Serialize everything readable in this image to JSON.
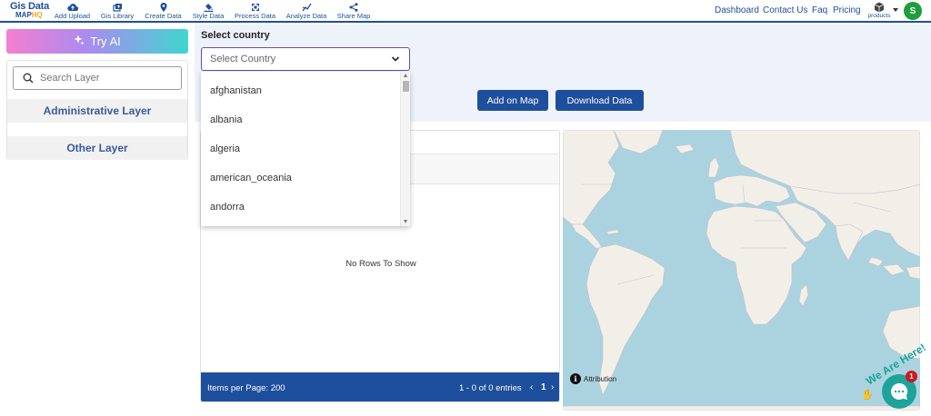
{
  "app": {
    "logo_line1": "Gis Data",
    "logo_line2_a": "MAP",
    "logo_line2_b": "HQ"
  },
  "nav": {
    "items": [
      {
        "label": "Add Upload",
        "icon": "cloud-upload-icon"
      },
      {
        "label": "Gis Library",
        "icon": "library-icon"
      },
      {
        "label": "Create Data",
        "icon": "map-pin-icon"
      },
      {
        "label": "Style Data",
        "icon": "paint-bucket-icon"
      },
      {
        "label": "Process Data",
        "icon": "process-icon"
      },
      {
        "label": "Analyze Data",
        "icon": "analyze-icon"
      },
      {
        "label": "Share Map",
        "icon": "share-icon"
      }
    ],
    "links": [
      "Dashboard",
      "Contact Us",
      "Faq",
      "Pricing"
    ],
    "products_label": "products",
    "avatar_initial": "S"
  },
  "sidebar": {
    "try_ai_label": "Try AI",
    "search_placeholder": "Search Layer",
    "layers": [
      "Administrative Layer",
      "Other Layer"
    ]
  },
  "controls": {
    "select_label": "Select country",
    "select_placeholder": "Select Country",
    "options": [
      "afghanistan",
      "albania",
      "algeria",
      "american_oceania",
      "andorra"
    ],
    "add_on_map_label": "Add on Map",
    "download_label": "Download Data"
  },
  "table": {
    "empty_text": "No Rows To Show",
    "items_per_page": "Items per Page: 200",
    "entries_text": "1 - 0 of 0 entries",
    "prev": "‹",
    "page": "1",
    "next": "›"
  },
  "map": {
    "attribution_label": "Attribution",
    "attribution_icon_text": "i",
    "ocean_color": "#aad3df",
    "land_color": "#f2efe9"
  },
  "chat": {
    "text": "We Are Here!",
    "badge_count": "1"
  },
  "colors": {
    "brand_blue": "#1e4f9c",
    "chat_teal": "#1ea39b",
    "avatar_green": "#1f9e3c"
  }
}
